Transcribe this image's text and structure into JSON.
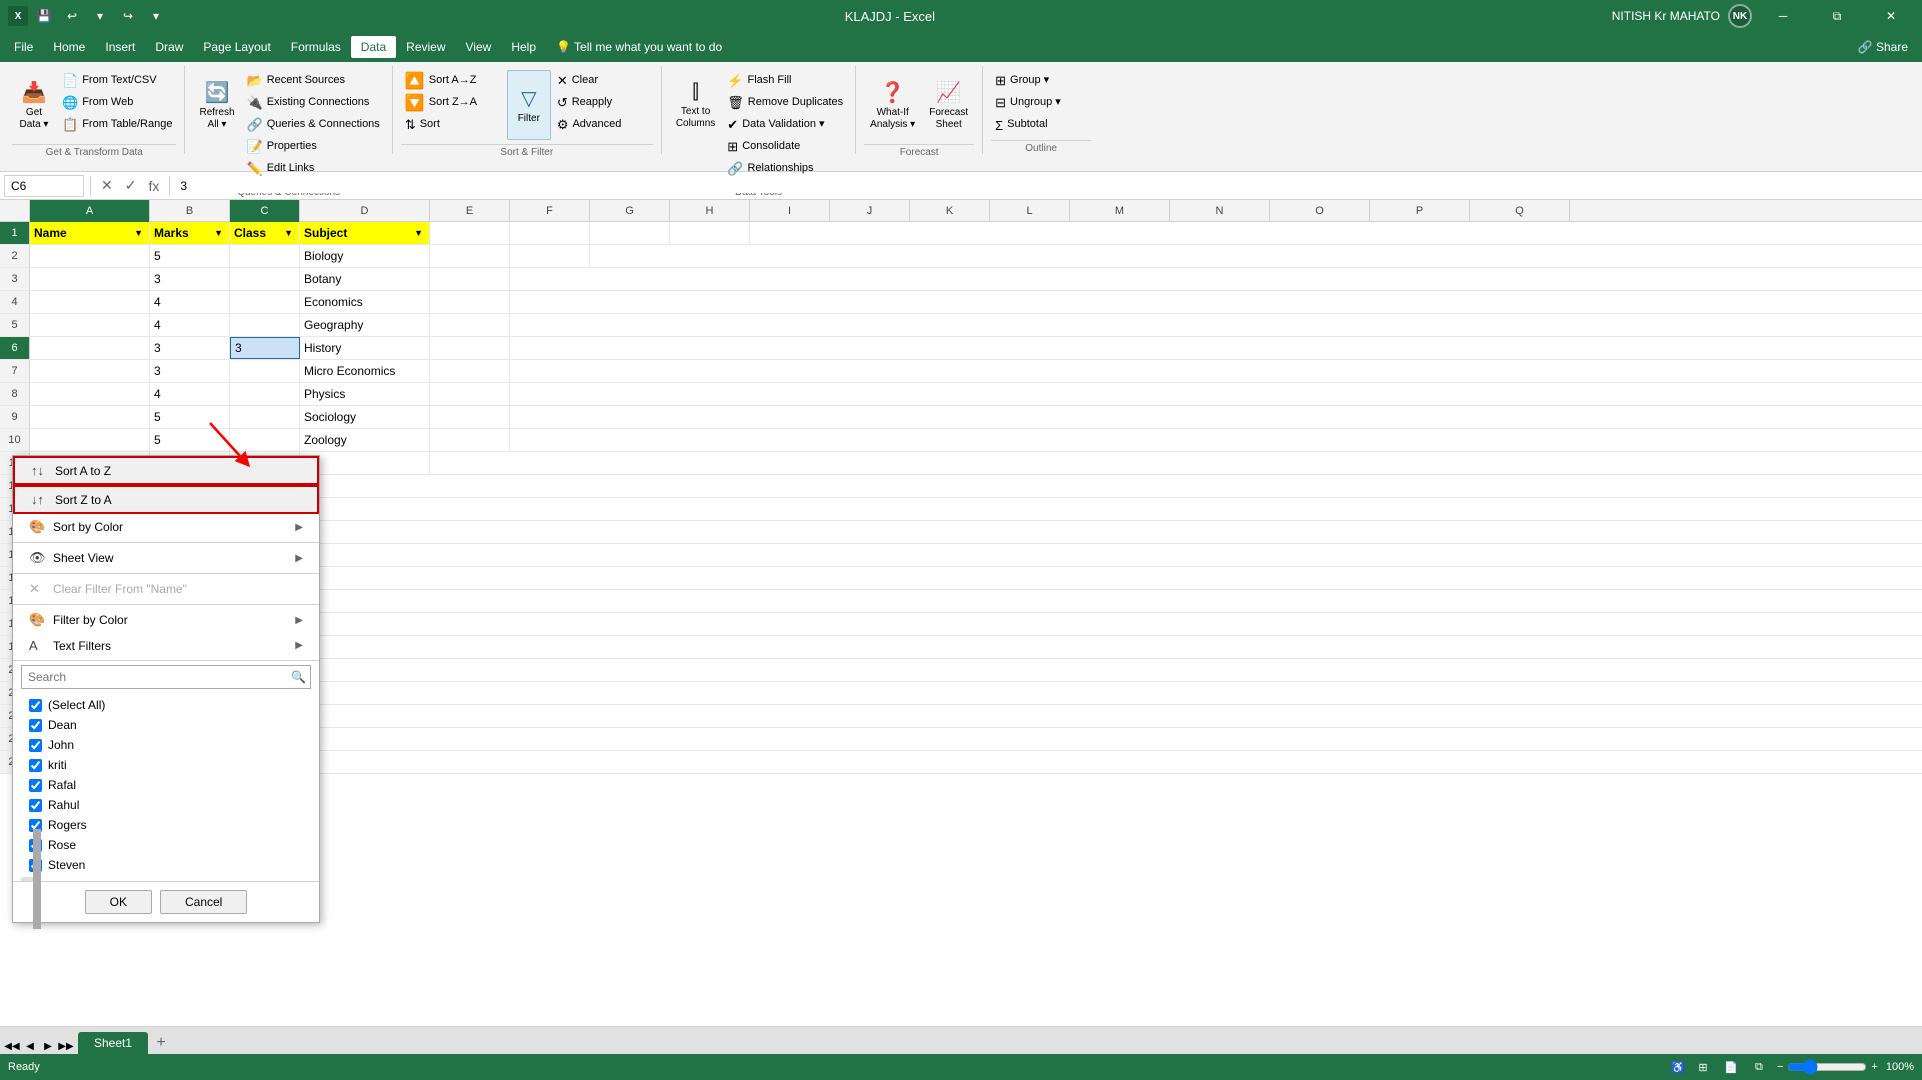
{
  "titlebar": {
    "title": "KLAJDJ  -  Excel",
    "user": "NITISH Kr MAHATO",
    "initials": "NK",
    "save_icon": "💾",
    "undo_icon": "↩",
    "redo_icon": "↪",
    "customize_icon": "▾"
  },
  "menubar": {
    "items": [
      "File",
      "Home",
      "Insert",
      "Draw",
      "Page Layout",
      "Formulas",
      "Data",
      "Review",
      "View",
      "Help"
    ],
    "active": "Data"
  },
  "ribbon": {
    "groups": [
      {
        "name": "Get & Transform Data",
        "buttons": [
          {
            "id": "get-data",
            "label": "Get\nData ▾",
            "icon": "📥",
            "size": "large"
          },
          {
            "id": "from-text",
            "label": "From Text/CSV",
            "icon": "📄",
            "size": "small"
          },
          {
            "id": "from-web",
            "label": "From Web",
            "icon": "🌐",
            "size": "small"
          },
          {
            "id": "from-table",
            "label": "From Table/Range",
            "icon": "📋",
            "size": "small"
          }
        ]
      },
      {
        "name": "Queries & Connections",
        "buttons": [
          {
            "id": "queries",
            "label": "Queries & Connections",
            "icon": "🔗",
            "size": "small"
          },
          {
            "id": "properties",
            "label": "Properties",
            "icon": "📝",
            "size": "small"
          },
          {
            "id": "edit-links",
            "label": "Edit Links",
            "icon": "✏️",
            "size": "small"
          },
          {
            "id": "recent-sources",
            "label": "Recent Sources",
            "icon": "📂",
            "size": "small"
          },
          {
            "id": "existing-conn",
            "label": "Existing Connections",
            "icon": "🔌",
            "size": "small"
          },
          {
            "id": "refresh-all",
            "label": "Refresh\nAll ▾",
            "icon": "🔄",
            "size": "large"
          }
        ]
      },
      {
        "name": "Sort & Filter",
        "buttons": [
          {
            "id": "sort-az",
            "label": "Sort A-Z",
            "icon": "↑",
            "size": "small"
          },
          {
            "id": "sort-za",
            "label": "Sort Z-A",
            "icon": "↓",
            "size": "small"
          },
          {
            "id": "sort",
            "label": "Sort",
            "icon": "⇅",
            "size": "small"
          },
          {
            "id": "filter",
            "label": "Filter",
            "icon": "▽",
            "size": "large",
            "active": true
          },
          {
            "id": "clear",
            "label": "Clear",
            "icon": "✕",
            "size": "small"
          },
          {
            "id": "reapply",
            "label": "Reapply",
            "icon": "↺",
            "size": "small"
          },
          {
            "id": "advanced",
            "label": "Advanced",
            "icon": "⚙",
            "size": "small"
          }
        ]
      },
      {
        "name": "Data Tools",
        "buttons": [
          {
            "id": "text-to-columns",
            "label": "Text to\nColumns",
            "icon": "⫿",
            "size": "large"
          },
          {
            "id": "flash-fill",
            "label": "Flash Fill",
            "icon": "⚡",
            "size": "small"
          },
          {
            "id": "remove-dupl",
            "label": "Remove Duplicates",
            "icon": "🗑",
            "size": "small"
          },
          {
            "id": "data-validation",
            "label": "Data Validation",
            "icon": "✔",
            "size": "small"
          },
          {
            "id": "consolidate",
            "label": "Consolidate",
            "icon": "⊞",
            "size": "small"
          },
          {
            "id": "relationships",
            "label": "Relationships",
            "icon": "🔗",
            "size": "small"
          }
        ]
      },
      {
        "name": "Forecast",
        "buttons": [
          {
            "id": "what-if",
            "label": "What-If\nAnalysis ▾",
            "icon": "❓",
            "size": "large"
          },
          {
            "id": "forecast-sheet",
            "label": "Forecast\nSheet",
            "icon": "📈",
            "size": "large"
          }
        ]
      },
      {
        "name": "Outline",
        "buttons": [
          {
            "id": "group",
            "label": "Group ▾",
            "icon": "⊞",
            "size": "small"
          },
          {
            "id": "ungroup",
            "label": "Ungroup ▾",
            "icon": "⊟",
            "size": "small"
          },
          {
            "id": "subtotal",
            "label": "Subtotal",
            "icon": "Σ",
            "size": "small"
          }
        ]
      }
    ]
  },
  "formulabar": {
    "cell_ref": "C6",
    "formula_value": "3",
    "cancel_label": "✕",
    "confirm_label": "✓",
    "fx_label": "fx"
  },
  "columns": [
    "A",
    "B",
    "C",
    "D",
    "E",
    "F",
    "G",
    "H",
    "I",
    "J",
    "K",
    "L",
    "M",
    "N",
    "O",
    "P",
    "Q"
  ],
  "headers": {
    "name": "Name",
    "marks": "Marks",
    "class": "Class",
    "subject": "Subject"
  },
  "data_rows": [
    {
      "row": 2,
      "a": "",
      "b": "5",
      "c": "",
      "d": "Biology"
    },
    {
      "row": 3,
      "a": "",
      "b": "3",
      "c": "",
      "d": "Botany"
    },
    {
      "row": 4,
      "a": "",
      "b": "4",
      "c": "",
      "d": "Economics"
    },
    {
      "row": 5,
      "a": "",
      "b": "4",
      "c": "",
      "d": "Geography"
    },
    {
      "row": 6,
      "a": "",
      "b": "3",
      "c": "3",
      "d": "History"
    },
    {
      "row": 7,
      "a": "",
      "b": "3",
      "c": "",
      "d": "Micro Economics"
    },
    {
      "row": 8,
      "a": "",
      "b": "4",
      "c": "",
      "d": "Physics"
    },
    {
      "row": 9,
      "a": "",
      "b": "5",
      "c": "",
      "d": "Sociology"
    },
    {
      "row": 10,
      "a": "",
      "b": "5",
      "c": "",
      "d": "Zoology"
    }
  ],
  "filter_dropdown": {
    "menu_items": [
      {
        "id": "sort-az",
        "label": "Sort A to Z",
        "icon": "↑↓",
        "has_submenu": false,
        "highlighted": true
      },
      {
        "id": "sort-za",
        "label": "Sort Z to A",
        "icon": "↓↑",
        "has_submenu": false,
        "highlighted": true
      },
      {
        "id": "sort-by-color",
        "label": "Sort by Color",
        "icon": "🎨",
        "has_submenu": true
      },
      {
        "id": "sheet-view",
        "label": "Sheet View",
        "icon": "👁",
        "has_submenu": true
      },
      {
        "id": "clear-filter",
        "label": "Clear Filter From \"Name\"",
        "icon": "✕",
        "has_submenu": false,
        "disabled": true
      },
      {
        "id": "filter-by-color",
        "label": "Filter by Color",
        "icon": "🎨",
        "has_submenu": true
      },
      {
        "id": "text-filters",
        "label": "Text Filters",
        "icon": "A",
        "has_submenu": true
      }
    ],
    "search_placeholder": "Search",
    "checkboxes": [
      {
        "label": "(Select All)",
        "checked": true
      },
      {
        "label": "Dean",
        "checked": true
      },
      {
        "label": "John",
        "checked": true
      },
      {
        "label": "kriti",
        "checked": true
      },
      {
        "label": "Rafal",
        "checked": true
      },
      {
        "label": "Rahul",
        "checked": true
      },
      {
        "label": "Rogers",
        "checked": true
      },
      {
        "label": "Rose",
        "checked": true
      },
      {
        "label": "Steven",
        "checked": true
      }
    ],
    "ok_label": "OK",
    "cancel_label": "Cancel"
  },
  "sheet_tabs": [
    {
      "id": "sheet1",
      "label": "Sheet1",
      "active": true
    }
  ],
  "statusbar": {
    "ready": "Ready",
    "zoom": "100%"
  }
}
